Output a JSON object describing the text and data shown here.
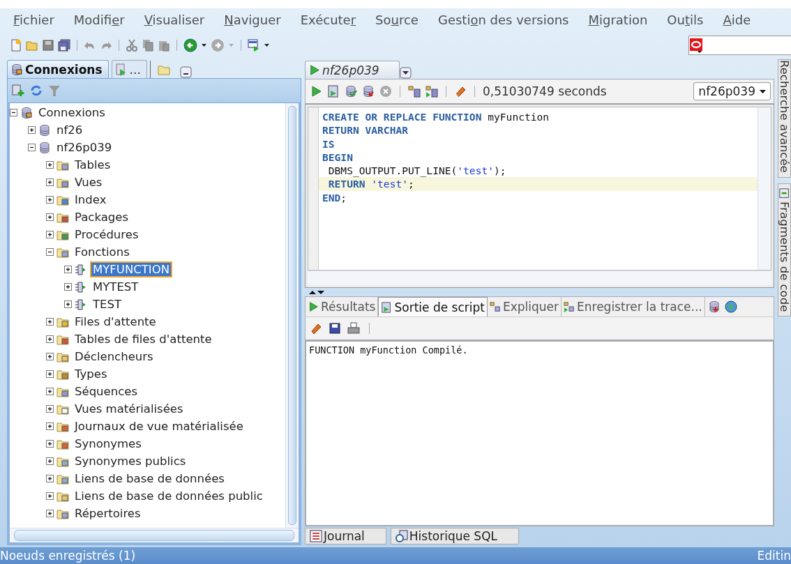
{
  "menu": [
    {
      "key": "F",
      "post": "ichier"
    },
    {
      "pre": "Modifi",
      "key": "e",
      "post": "r"
    },
    {
      "key": "V",
      "post": "isualiser"
    },
    {
      "key": "N",
      "post": "aviguer"
    },
    {
      "pre": "Exécute",
      "key": "r"
    },
    {
      "pre": "So",
      "key": "u",
      "post": "rce"
    },
    {
      "pre": "Gesti",
      "key": "o",
      "post": "n des versions"
    },
    {
      "key": "M",
      "post": "igration"
    },
    {
      "pre": "Ou",
      "key": "t",
      "post": "ils"
    },
    {
      "key": "A",
      "post": "ide"
    }
  ],
  "navigator": {
    "tabs": [
      {
        "label": "Connexions",
        "selected": true
      },
      {
        "label": "...",
        "selected": false
      },
      {
        "selected": false
      }
    ],
    "tree": [
      {
        "label": "Connexions",
        "expanded": true,
        "selected": false,
        "children": [
          {
            "label": "nf26",
            "expanded": false,
            "selected": false
          },
          {
            "label": "nf26p039",
            "expanded": true,
            "selected": false,
            "children": [
              {
                "label": "Tables",
                "expanded": false,
                "selected": false
              },
              {
                "label": "Vues",
                "expanded": false,
                "selected": false
              },
              {
                "label": "Index",
                "expanded": false,
                "selected": false
              },
              {
                "label": "Packages",
                "expanded": false,
                "selected": false
              },
              {
                "label": "Procédures",
                "expanded": false,
                "selected": false
              },
              {
                "label": "Fonctions",
                "expanded": true,
                "selected": false,
                "children": [
                  {
                    "label": "MYFUNCTION",
                    "expanded": false,
                    "selected": true
                  },
                  {
                    "label": "MYTEST",
                    "expanded": false,
                    "selected": false
                  },
                  {
                    "label": "TEST",
                    "expanded": false,
                    "selected": false
                  }
                ]
              },
              {
                "label": "Files d'attente",
                "expanded": false,
                "selected": false
              },
              {
                "label": "Tables de files d'attente",
                "expanded": false,
                "selected": false
              },
              {
                "label": "Déclencheurs",
                "expanded": false,
                "selected": false
              },
              {
                "label": "Types",
                "expanded": false,
                "selected": false
              },
              {
                "label": "Séquences",
                "expanded": false,
                "selected": false
              },
              {
                "label": "Vues matérialisées",
                "expanded": false,
                "selected": false
              },
              {
                "label": "Journaux de vue matérialisée",
                "expanded": false,
                "selected": false
              },
              {
                "label": "Synonymes",
                "expanded": false,
                "selected": false
              },
              {
                "label": "Synonymes publics",
                "expanded": false,
                "selected": false
              },
              {
                "label": "Liens de base de données",
                "expanded": false,
                "selected": false
              },
              {
                "label": "Liens de base de données public",
                "expanded": false,
                "selected": false
              },
              {
                "label": "Répertoires",
                "expanded": false,
                "selected": false
              }
            ]
          }
        ]
      }
    ]
  },
  "editor": {
    "tab": "nf26p039",
    "elapsed": "0,51030749 seconds",
    "connection": "nf26p039",
    "lines": [
      {
        "highlighted": false,
        "segments": [
          {
            "text": "CREATE OR REPLACE FUNCTION",
            "kind": "keyword"
          },
          {
            "text": " myFunction",
            "kind": "plain"
          }
        ]
      },
      {
        "highlighted": false,
        "segments": [
          {
            "text": "RETURN VARCHAR",
            "kind": "keyword"
          }
        ]
      },
      {
        "highlighted": false,
        "segments": [
          {
            "text": "IS",
            "kind": "keyword"
          }
        ]
      },
      {
        "highlighted": false,
        "segments": [
          {
            "text": "BEGIN",
            "kind": "keyword"
          }
        ]
      },
      {
        "highlighted": false,
        "segments": [
          {
            "text": " DBMS_OUTPUT.PUT_LINE(",
            "kind": "plain"
          },
          {
            "text": "'test'",
            "kind": "string"
          },
          {
            "text": ");",
            "kind": "plain"
          }
        ]
      },
      {
        "highlighted": true,
        "segments": [
          {
            "text": " RETURN ",
            "kind": "keyword"
          },
          {
            "text": "'test'",
            "kind": "string"
          },
          {
            "text": ";",
            "kind": "plain"
          }
        ]
      },
      {
        "highlighted": false,
        "segments": [
          {
            "text": "END",
            "kind": "keyword"
          },
          {
            "text": ";",
            "kind": "plain"
          }
        ]
      }
    ]
  },
  "results": {
    "tabs": [
      {
        "label": "Résultats",
        "selected": false
      },
      {
        "label": "Sortie de script",
        "selected": true
      },
      {
        "label": "Expliquer",
        "selected": false
      },
      {
        "label": "Enregistrer la trace...",
        "selected": false
      }
    ],
    "output": "FUNCTION myFunction Compilé."
  },
  "bottom_tabs": [
    "Journal",
    "Historique SQL"
  ],
  "side_tabs": [
    "Recherche avancée",
    "Fragments de code"
  ],
  "status_bar": {
    "left": "Noeuds enregistrés (1)",
    "right": "Editin"
  }
}
